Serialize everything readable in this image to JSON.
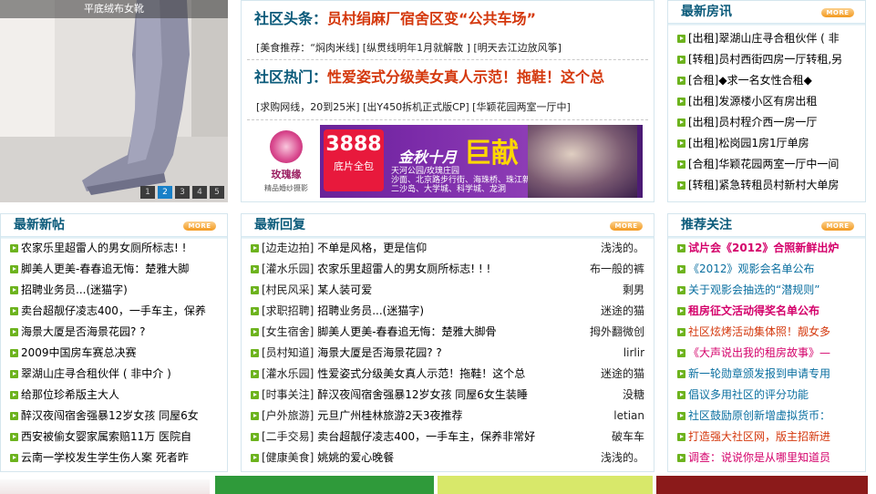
{
  "slideshow": {
    "caption": "平底绒布女靴",
    "pages": [
      "1",
      "2",
      "3",
      "4",
      "5"
    ],
    "active_page": 2
  },
  "community_news": {
    "headline1": {
      "label": "社区头条：",
      "text": "员村绢麻厂宿舍区变“公共车场”"
    },
    "tags1": "[美食推荐：“焖肉米线] [纵贯线明年1月就解散 ] [明天去江边放风筝]",
    "headline2": {
      "label": "社区热门：",
      "text": "性爱姿式分级美女真人示范！拖鞋！这个总"
    },
    "tags2": "[求购网线，20到25米] [出Y450拆机正式版CP] [华颖花园两室一厅中]"
  },
  "banner": {
    "logo_name": "玫瑰缘",
    "logo_sub": "精品婚纱摄影",
    "price": "3888",
    "price_sub": "底片全包",
    "slogan": "金秋十月",
    "slogan_big": "巨献",
    "venues_line1": "天河公园/玫瑰庄园",
    "venues_line2": "沙面、北京路步行街、海珠桥、珠江新城、",
    "venues_line3": "二沙岛、大学城、科学城、龙洞"
  },
  "housing": {
    "title": "最新房讯",
    "more_label": "MORE",
    "items": [
      "[出租]翠湖山庄寻合租伙伴 ( 非",
      "[转租]员村西街四房一厅转租,另",
      "[合租]◆求一名女性合租◆",
      "[出租]发源楼小区有房出租",
      "[出租]员村程介西一房一厅",
      "[出租]松岗园1房1厅单房",
      "[合租]华颖花园两室一厅中一间",
      "[转租]紧急转租员村新村大单房"
    ]
  },
  "new_posts": {
    "title": "最新新帖",
    "more_label": "MORE",
    "items": [
      "农家乐里超雷人的男女厕所标志! !",
      "脚美人更美-春春追无悔：楚雅大脚",
      "招聘业务员...(迷猫字)",
      "卖台超靓仔凌志400，一手车主，保养",
      "海景大厦是否海景花园? ?",
      "2009中国房车赛总决赛",
      "翠湖山庄寻合租伙伴 ( 非中介 )",
      "给那位珍希版主大人",
      "醉汉夜闯宿舍强暴12岁女孩 同屋6女",
      "西安被偷女婴家属索赔11万 医院自",
      "云南一学校发生学生伤人案 死者昨"
    ]
  },
  "replies": {
    "title": "最新回复",
    "more_label": "MORE",
    "items": [
      {
        "cat": "[边走边拍]",
        "text": "不单是风格，更是信仰",
        "author": "浅浅的。"
      },
      {
        "cat": "[灌水乐园]",
        "text": "农家乐里超雷人的男女厕所标志! ! !",
        "author": "布一般的裤"
      },
      {
        "cat": "[村民风采]",
        "text": "某人装可爱",
        "author": "剩男"
      },
      {
        "cat": "[求职招聘]",
        "text": "招聘业务员...(迷猫字)",
        "author": "迷途的猫"
      },
      {
        "cat": "[女生宿舍]",
        "text": "脚美人更美-春春追无悔：楚雅大脚骨",
        "author": "拇外翻微创"
      },
      {
        "cat": "[员村知道]",
        "text": "海景大厦是否海景花园? ?",
        "author": "lirlir"
      },
      {
        "cat": "[灌水乐园]",
        "text": "性爱姿式分级美女真人示范！拖鞋！这个总",
        "author": "迷途的猫"
      },
      {
        "cat": "[时事关注]",
        "text": "醉汉夜闯宿舍强暴12岁女孩 同屋6女生装睡",
        "author": "没糖"
      },
      {
        "cat": "[户外旅游]",
        "text": "元旦广州桂林旅游2天3夜推荐",
        "author": "letian"
      },
      {
        "cat": "[二手交易]",
        "text": "卖台超靓仔凌志400，一手车主，保养非常好",
        "author": "破车车"
      },
      {
        "cat": "[健康美食]",
        "text": "姚姚的爱心晚餐",
        "author": "浅浅的。"
      }
    ]
  },
  "recommend": {
    "title": "推荐关注",
    "more_label": "MORE",
    "items": [
      {
        "text": "试片会《2012》合照新鲜出炉",
        "color": "#d4006a",
        "hot": true
      },
      {
        "text": "《2012》观影会名单公布",
        "color": "#0a6fa0",
        "hot": false
      },
      {
        "text": "关于观影会抽选的“潜规则”",
        "color": "#0a6fa0",
        "hot": false
      },
      {
        "text": "租房征文活动得奖名单公布",
        "color": "#d4006a",
        "hot": true
      },
      {
        "text": "社区炫烤活动集体照！靓女多",
        "color": "#d4380d",
        "hot": false
      },
      {
        "text": "《大声说出我的租房故事》—",
        "color": "#d4006a",
        "hot": false
      },
      {
        "text": "新一轮勋章颁发报到申请专用",
        "color": "#0a6fa0",
        "hot": false
      },
      {
        "text": "倡议多用社区的评分功能",
        "color": "#0a6fa0",
        "hot": false
      },
      {
        "text": "社区鼓励原创新增虚拟货币：",
        "color": "#0a6fa0",
        "hot": false
      },
      {
        "text": "打造强大社区网，版主招新进",
        "color": "#d4380d",
        "hot": false
      },
      {
        "text": "调查：说说你是从哪里知道员",
        "color": "#d4006a",
        "hot": false
      }
    ]
  },
  "colors": {
    "bullet_green": "#6db31e",
    "title_blue": "#0a5a7a",
    "headline_red": "#d4380d",
    "border": "#d5e6ee"
  }
}
